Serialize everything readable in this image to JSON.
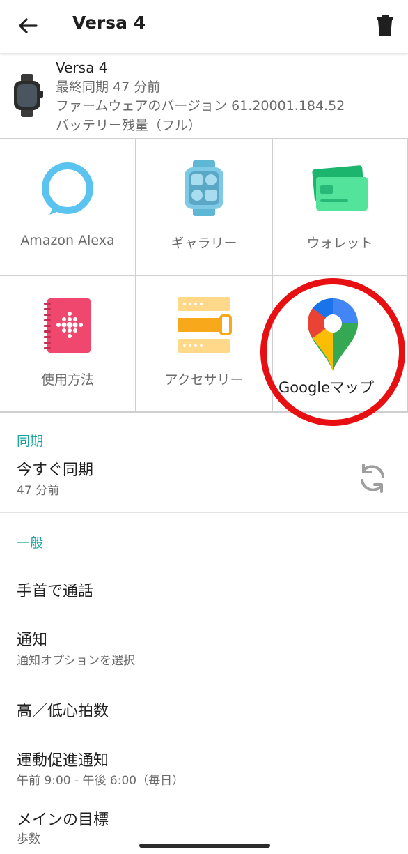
{
  "header": {
    "title": "Versa 4",
    "back_icon": "arrow-back-icon",
    "delete_icon": "trash-icon"
  },
  "device": {
    "name": "Versa 4",
    "last_sync": "最終同期 47 分前",
    "firmware": "ファームウェアのバージョン 61.20001.184.52",
    "battery": "バッテリー残量（フル）"
  },
  "tiles": [
    {
      "label": "Amazon Alexa",
      "icon": "alexa-icon"
    },
    {
      "label": "ギャラリー",
      "icon": "watch-gallery-icon"
    },
    {
      "label": "ウォレット",
      "icon": "wallet-cards-icon"
    },
    {
      "label": "使用方法",
      "icon": "manual-notebook-icon"
    },
    {
      "label": "アクセサリー",
      "icon": "accessory-bands-icon"
    },
    {
      "label": "Googleマップ",
      "icon": "google-maps-pin-icon"
    }
  ],
  "highlight": {
    "color": "#e80f12",
    "target": "Googleマップ"
  },
  "sync": {
    "section": "同期",
    "title": "今すぐ同期",
    "subtitle": "47 分前",
    "icon": "sync-icon"
  },
  "general": {
    "section": "一般",
    "items": [
      {
        "title": "手首で通話",
        "subtitle": ""
      },
      {
        "title": "通知",
        "subtitle": "通知オプションを選択"
      },
      {
        "title": "高／低心拍数",
        "subtitle": ""
      },
      {
        "title": "運動促進通知",
        "subtitle": "午前 9:00 - 午後 6:00（毎日）"
      },
      {
        "title": "メインの目標",
        "subtitle": "歩数"
      }
    ]
  },
  "colors": {
    "accent": "#1aa5a0",
    "alexa": "#5bc3f0",
    "wallet": "#3ad68b",
    "manual": "#f0476f",
    "accessory": "#f7a81b"
  }
}
